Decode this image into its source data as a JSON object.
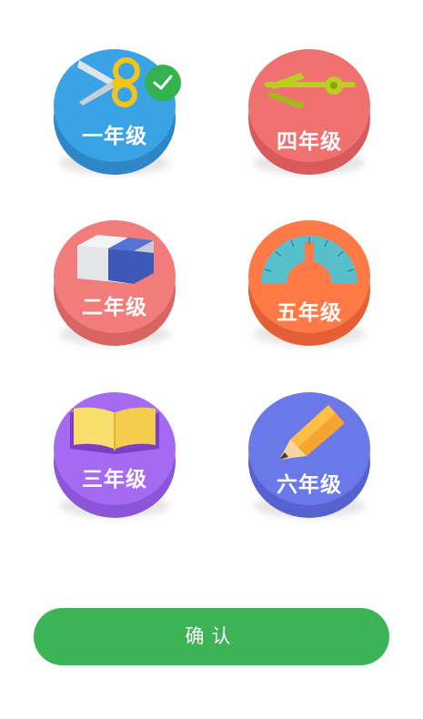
{
  "grades": [
    {
      "label": "一年级",
      "icon": "scissors-icon",
      "top_color": "#3aa3e6",
      "base_color": "#2f86c6",
      "selected": true
    },
    {
      "label": "四年级",
      "icon": "compass-icon",
      "top_color": "#f07270",
      "base_color": "#d95a5b",
      "selected": false
    },
    {
      "label": "二年级",
      "icon": "eraser-icon",
      "top_color": "#f27b7b",
      "base_color": "#d86463",
      "selected": false
    },
    {
      "label": "五年级",
      "icon": "protractor-icon",
      "top_color": "#ff7a47",
      "base_color": "#e45f35",
      "selected": false
    },
    {
      "label": "三年级",
      "icon": "book-icon",
      "top_color": "#a56af2",
      "base_color": "#8b55d9",
      "selected": false
    },
    {
      "label": "六年级",
      "icon": "pencil-icon",
      "top_color": "#6b79e8",
      "base_color": "#5562cf",
      "selected": false
    }
  ],
  "confirm_label": "确认"
}
